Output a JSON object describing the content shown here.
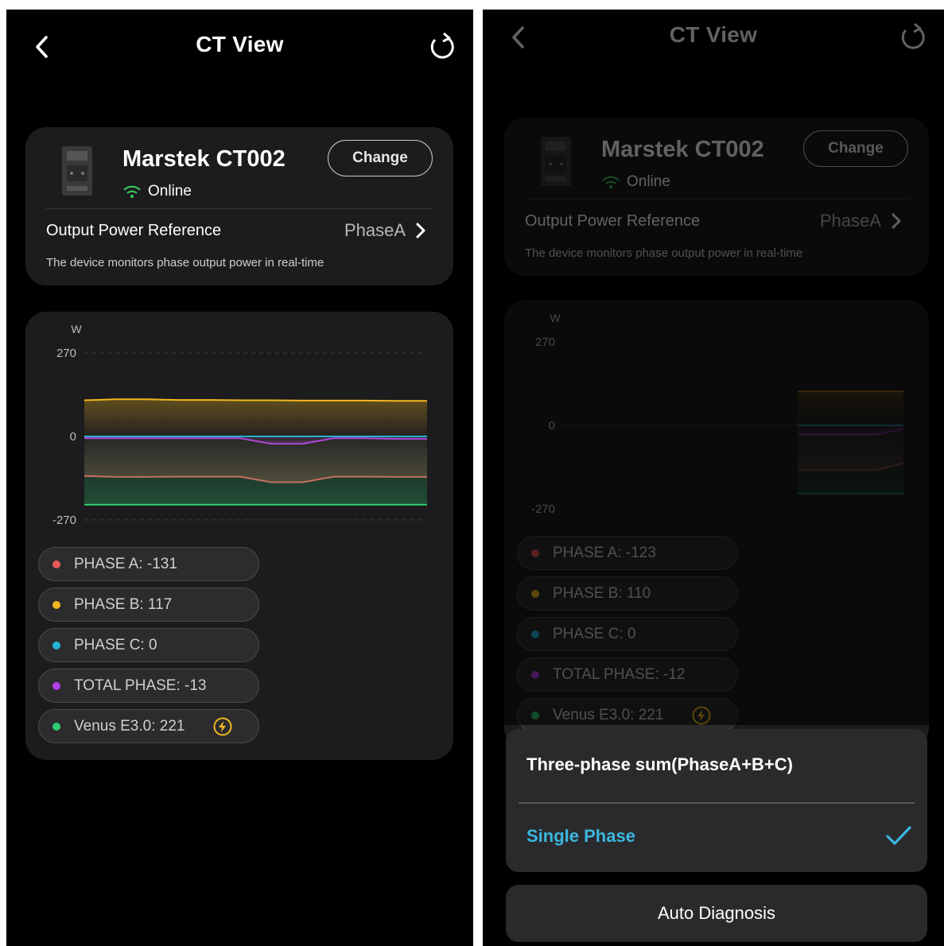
{
  "screens": [
    {
      "nav": {
        "title": "CT View"
      },
      "device": {
        "name": "Marstek CT002",
        "status": "Online",
        "change_label": "Change"
      },
      "reference": {
        "label": "Output Power Reference",
        "value": "PhaseA",
        "description": "The device monitors phase output power in real-time"
      },
      "legend": [
        {
          "label": "PHASE A: -131",
          "color": "#e85a5a"
        },
        {
          "label": "PHASE B: 117",
          "color": "#f1b81e"
        },
        {
          "label": "PHASE C: 0",
          "color": "#24b4d6"
        },
        {
          "label": "TOTAL PHASE: -13",
          "color": "#b33ee8"
        },
        {
          "label": "Venus E3.0: 221",
          "color": "#2ecc71"
        }
      ]
    },
    {
      "nav": {
        "title": "CT View"
      },
      "device": {
        "name": "Marstek CT002",
        "status": "Online",
        "change_label": "Change"
      },
      "reference": {
        "label": "Output Power Reference",
        "value": "PhaseA",
        "description": "The device monitors phase output power in real-time"
      },
      "legend": [
        {
          "label": "PHASE A: -123",
          "color": "#e85a5a"
        },
        {
          "label": "PHASE B: 110",
          "color": "#f1b81e"
        },
        {
          "label": "PHASE C: 0",
          "color": "#24b4d6"
        },
        {
          "label": "TOTAL PHASE: -12",
          "color": "#b33ee8"
        },
        {
          "label": "Venus E3.0: 221",
          "color": "#2ecc71"
        }
      ],
      "sheet": {
        "options": [
          "Three-phase sum(PhaseA+B+C)",
          "Single Phase"
        ],
        "selected_index": 1,
        "diagnosis_label": "Auto Diagnosis"
      }
    }
  ],
  "chart_data": [
    {
      "type": "area",
      "ylabel": "W",
      "ylim": [
        -270,
        270
      ],
      "yticks": [
        "270",
        "0",
        "-270"
      ],
      "series": [
        {
          "color": "#f1b81e",
          "values": [
            117,
            120,
            120,
            118,
            118,
            117,
            117,
            116,
            116,
            116,
            115,
            115
          ]
        },
        {
          "color": "#24b4d6",
          "values": [
            0,
            0,
            0,
            0,
            0,
            0,
            0,
            0,
            0,
            0,
            0,
            0
          ]
        },
        {
          "color": "#b33ee8",
          "values": [
            -6,
            -6,
            -6,
            -6,
            -6,
            -6,
            -24,
            -24,
            -6,
            -6,
            -8,
            -8
          ]
        },
        {
          "color": "#e85a5a",
          "values": [
            -128,
            -131,
            -131,
            -130,
            -130,
            -130,
            -148,
            -148,
            -130,
            -130,
            -131,
            -131
          ]
        },
        {
          "color": "#2ecc71",
          "values": [
            -221,
            -221,
            -221,
            -221,
            -221,
            -221,
            -221,
            -221,
            -221,
            -221,
            -221,
            -221
          ]
        }
      ]
    },
    {
      "type": "area",
      "ylabel": "W",
      "ylim": [
        -270,
        270
      ],
      "yticks": [
        "270",
        "0",
        "-270"
      ],
      "series": [
        {
          "color": "#f1b81e",
          "values": [
            110,
            110,
            110,
            110,
            110
          ]
        },
        {
          "color": "#24b4d6",
          "values": [
            0,
            0,
            0,
            0,
            0
          ]
        },
        {
          "color": "#b33ee8",
          "values": [
            -30,
            -30,
            -30,
            -30,
            -12
          ]
        },
        {
          "color": "#e85a5a",
          "values": [
            -145,
            -145,
            -145,
            -145,
            -123
          ]
        },
        {
          "color": "#2ecc71",
          "values": [
            -221,
            -221,
            -221,
            -221,
            -221
          ]
        }
      ]
    }
  ]
}
